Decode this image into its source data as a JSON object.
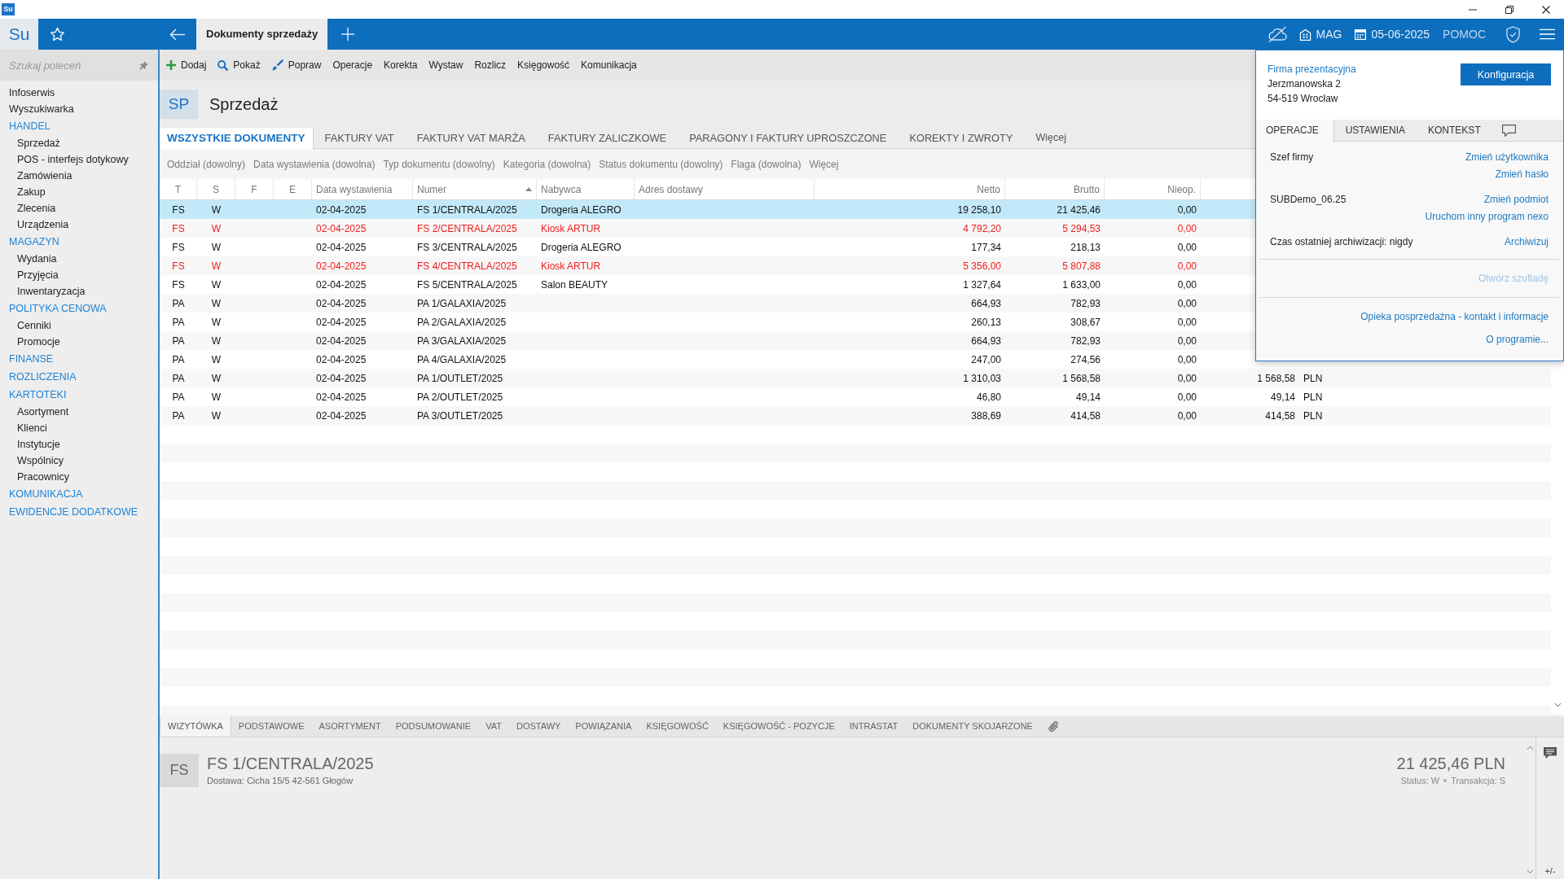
{
  "window": {
    "app_icon": "Su"
  },
  "top_bar": {
    "logo": "Su",
    "tabs": [
      {
        "label": "Dokumenty sprzedaży",
        "selected": true
      }
    ],
    "warehouse": "MAG",
    "date": "05-06-2025",
    "help": "POMOC"
  },
  "sidebar": {
    "search_placeholder": "Szukaj poleceń",
    "items": [
      {
        "label": "Infoserwis",
        "kind": "link"
      },
      {
        "label": "Wyszukiwarka",
        "kind": "link"
      },
      {
        "label": "HANDEL",
        "kind": "section",
        "children": [
          {
            "label": "Sprzedaż"
          },
          {
            "label": "POS - interfejs dotykowy"
          },
          {
            "label": "Zamówienia"
          },
          {
            "label": "Zakup"
          },
          {
            "label": "Zlecenia"
          },
          {
            "label": "Urządzenia"
          }
        ]
      },
      {
        "label": "MAGAZYN",
        "kind": "section",
        "children": [
          {
            "label": "Wydania"
          },
          {
            "label": "Przyjęcia"
          },
          {
            "label": "Inwentaryzacja"
          }
        ]
      },
      {
        "label": "POLITYKA CENOWA",
        "kind": "section",
        "children": [
          {
            "label": "Cenniki"
          },
          {
            "label": "Promocje"
          }
        ]
      },
      {
        "label": "FINANSE",
        "kind": "section"
      },
      {
        "label": "ROZLICZENIA",
        "kind": "section"
      },
      {
        "label": "KARTOTEKI",
        "kind": "section",
        "children": [
          {
            "label": "Asortyment"
          },
          {
            "label": "Klienci"
          },
          {
            "label": "Instytucje"
          },
          {
            "label": "Wspólnicy"
          },
          {
            "label": "Pracownicy"
          }
        ]
      },
      {
        "label": "KOMUNIKACJA",
        "kind": "section"
      },
      {
        "label": "EWIDENCJE DODATKOWE",
        "kind": "section"
      }
    ]
  },
  "toolbar": [
    "Dodaj",
    "Pokaż",
    "Popraw",
    "Operacje",
    "Korekta",
    "Wystaw",
    "Rozlicz",
    "Księgowość",
    "Komunikacja"
  ],
  "module": {
    "badge": "SP",
    "title": "Sprzedaż"
  },
  "tabs": [
    {
      "label": "WSZYSTKIE DOKUMENTY",
      "selected": true
    },
    {
      "label": "FAKTURY VAT",
      "selected": false
    },
    {
      "label": "FAKTURY VAT MARŻA",
      "selected": false
    },
    {
      "label": "FAKTURY ZALICZKOWE",
      "selected": false
    },
    {
      "label": "PARAGONY I FAKTURY UPROSZCZONE",
      "selected": false
    },
    {
      "label": "KOREKTY I ZWROTY",
      "selected": false
    }
  ],
  "tabs_more": "Więcej",
  "filters": [
    "Oddział (dowolny)",
    "Data wystawienia (dowolna)",
    "Typ dokumentu (dowolny)",
    "Kategoria (dowolna)",
    "Status dokumentu (dowolny)",
    "Flaga (dowolna)",
    "Więcej"
  ],
  "table": {
    "columns": [
      {
        "label": "T",
        "sorted": false
      },
      {
        "label": "S",
        "sorted": false
      },
      {
        "label": "F",
        "sorted": false
      },
      {
        "label": "E",
        "sorted": false
      },
      {
        "label": "Data wystawienia",
        "sorted": false
      },
      {
        "label": "Numer",
        "sorted": true
      },
      {
        "label": "Nabywca",
        "sorted": false
      },
      {
        "label": "Adres dostawy",
        "sorted": false
      },
      {
        "label": "Netto",
        "sorted": false
      },
      {
        "label": "Brutto",
        "sorted": false
      },
      {
        "label": "Nieop.",
        "sorted": false
      }
    ],
    "rows": [
      {
        "t": "FS",
        "s": "W",
        "date": "02-04-2025",
        "number": "FS 1/CENTRALA/2025",
        "buyer": "Drogeria ALEGRO",
        "netto": "19 258,10",
        "brutto": "21 425,46",
        "nieop": "0,00",
        "selected": true,
        "warning": false
      },
      {
        "t": "FS",
        "s": "W",
        "date": "02-04-2025",
        "number": "FS 2/CENTRALA/2025",
        "buyer": "Kiosk ARTUR",
        "netto": "4 792,20",
        "brutto": "5 294,53",
        "nieop": "0,00",
        "selected": false,
        "warning": true
      },
      {
        "t": "FS",
        "s": "W",
        "date": "02-04-2025",
        "number": "FS 3/CENTRALA/2025",
        "buyer": "Drogeria ALEGRO",
        "netto": "177,34",
        "brutto": "218,13",
        "nieop": "0,00",
        "selected": false,
        "warning": false
      },
      {
        "t": "FS",
        "s": "W",
        "date": "02-04-2025",
        "number": "FS 4/CENTRALA/2025",
        "buyer": "Kiosk ARTUR",
        "netto": "5 356,00",
        "brutto": "5 807,88",
        "nieop": "0,00",
        "selected": false,
        "warning": true
      },
      {
        "t": "FS",
        "s": "W",
        "date": "02-04-2025",
        "number": "FS 5/CENTRALA/2025",
        "buyer": "Salon BEAUTY",
        "netto": "1 327,64",
        "brutto": "1 633,00",
        "nieop": "0,00",
        "selected": false,
        "warning": false
      },
      {
        "t": "PA",
        "s": "W",
        "date": "02-04-2025",
        "number": "PA 1/GALAXIA/2025",
        "netto": "664,93",
        "brutto": "782,93",
        "nieop": "0,00",
        "selected": false,
        "warning": false
      },
      {
        "t": "PA",
        "s": "W",
        "date": "02-04-2025",
        "number": "PA 2/GALAXIA/2025",
        "netto": "260,13",
        "brutto": "308,67",
        "nieop": "0,00",
        "selected": false,
        "warning": false
      },
      {
        "t": "PA",
        "s": "W",
        "date": "02-04-2025",
        "number": "PA 3/GALAXIA/2025",
        "netto": "664,93",
        "brutto": "782,93",
        "nieop": "0,00",
        "selected": false,
        "warning": false
      },
      {
        "t": "PA",
        "s": "W",
        "date": "02-04-2025",
        "number": "PA 4/GALAXIA/2025",
        "netto": "247,00",
        "brutto": "274,56",
        "nieop": "0,00",
        "selected": false,
        "warning": false
      },
      {
        "t": "PA",
        "s": "W",
        "date": "02-04-2025",
        "number": "PA 1/OUTLET/2025",
        "netto": "1 310,03",
        "brutto": "1 568,58",
        "nieop": "0,00",
        "column_12": "1 568,58",
        "column_13": "PLN",
        "selected": false,
        "warning": false
      },
      {
        "t": "PA",
        "s": "W",
        "date": "02-04-2025",
        "number": "PA 2/OUTLET/2025",
        "netto": "46,80",
        "brutto": "49,14",
        "nieop": "0,00",
        "column_12": "49,14",
        "column_13": "PLN",
        "selected": false,
        "warning": false
      },
      {
        "t": "PA",
        "s": "W",
        "date": "02-04-2025",
        "number": "PA 3/OUTLET/2025",
        "netto": "388,69",
        "brutto": "414,58",
        "nieop": "0,00",
        "column_12": "414,58",
        "column_13": "PLN",
        "selected": false,
        "warning": false
      }
    ]
  },
  "popup": {
    "company": "Firma prezentacyjna",
    "address": [
      "Jerzmanowska 2",
      "54-519 Wrocław"
    ],
    "button": "Konfiguracja",
    "tabs": [
      {
        "kind": "text",
        "label": "OPERACJE",
        "selected": true
      },
      {
        "kind": "text",
        "label": "USTAWIENIA",
        "selected": false
      },
      {
        "kind": "text",
        "label": "KONTEKST",
        "selected": false
      },
      {
        "kind": "chat",
        "selected": false
      }
    ],
    "sections": [
      {
        "label": "Szef firmy",
        "links": [
          "Zmień użytkownika",
          "Zmień hasło"
        ]
      },
      {
        "label": "SUBDemo_06.25",
        "links": [
          "Zmień podmiot",
          "Uruchom inny program nexo"
        ]
      },
      {
        "label": "Czas ostatniej archiwizacji: nigdy",
        "links": [
          "Archiwizuj"
        ]
      }
    ],
    "actions": [
      {
        "label": "Otwórz szufladę",
        "disabled": true
      }
    ],
    "footer_links": [
      "Opieka posprzedażna - kontakt i informacje",
      "O programie..."
    ]
  },
  "details": {
    "tabs": [
      {
        "label": "WIZYTÓWKA",
        "selected": true
      },
      {
        "label": "PODSTAWOWE",
        "selected": false
      },
      {
        "label": "ASORTYMENT",
        "selected": false
      },
      {
        "label": "PODSUMOWANIE",
        "selected": false
      },
      {
        "label": "VAT",
        "selected": false
      },
      {
        "label": "DOSTAWY",
        "selected": false
      },
      {
        "label": "POWIĄZANIA",
        "selected": false
      },
      {
        "label": "KSIĘGOWOŚĆ",
        "selected": false
      },
      {
        "label": "KSIĘGOWOŚĆ - POZYCJE",
        "selected": false
      },
      {
        "label": "INTRASTAT",
        "selected": false
      },
      {
        "label": "DOKUMENTY SKOJARZONE",
        "selected": false
      }
    ],
    "badge": "FS",
    "number": "FS 1/CENTRALA/2025",
    "delivery": "Dostawa: Cicha 15/5 42-561 Głogów",
    "total": "21 425,46 PLN",
    "status": "Status: W",
    "transaction": "Transakcja: S",
    "toggle": "+/-"
  }
}
